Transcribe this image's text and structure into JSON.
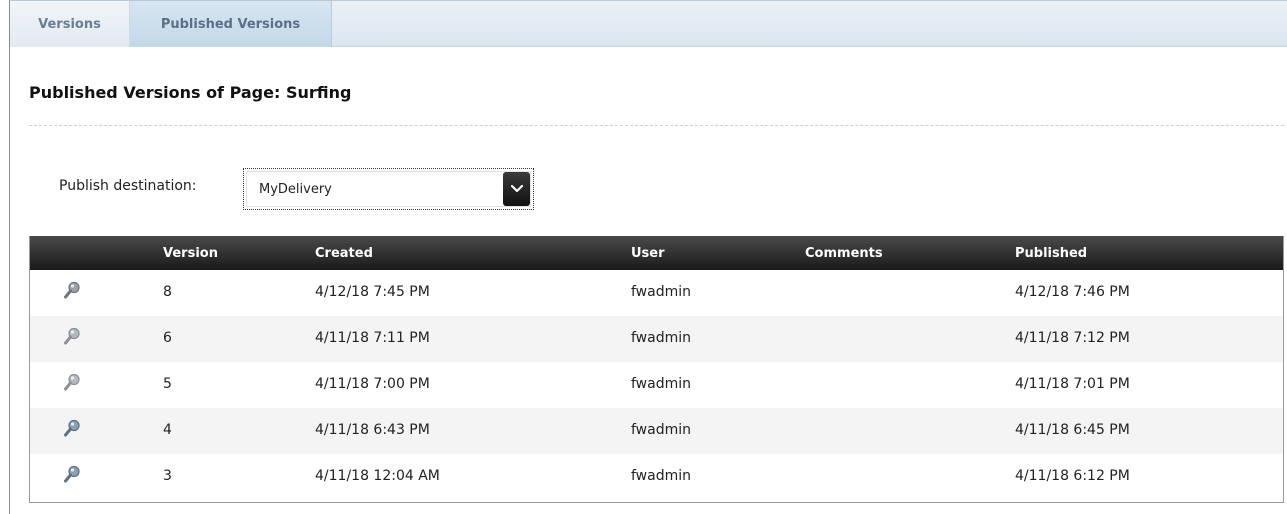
{
  "tabs": [
    {
      "label": "Versions"
    },
    {
      "label": "Published Versions"
    }
  ],
  "page": {
    "title": "Published Versions of Page: Surfing"
  },
  "destination": {
    "label": "Publish destination:",
    "value": "MyDelivery"
  },
  "table": {
    "columns": {
      "version": "Version",
      "created": "Created",
      "user": "User",
      "comments": "Comments",
      "published": "Published"
    },
    "rows": [
      {
        "version": "8",
        "created": "4/12/18 7:45 PM",
        "user": "fwadmin",
        "comments": "",
        "published": "4/12/18 7:46 PM",
        "icon": "magnifier-icon"
      },
      {
        "version": "6",
        "created": "4/11/18 7:11 PM",
        "user": "fwadmin",
        "comments": "",
        "published": "4/11/18 7:12 PM",
        "icon": "magnifier-icon"
      },
      {
        "version": "5",
        "created": "4/11/18 7:00 PM",
        "user": "fwadmin",
        "comments": "",
        "published": "4/11/18 7:01 PM",
        "icon": "magnifier-icon"
      },
      {
        "version": "4",
        "created": "4/11/18 6:43 PM",
        "user": "fwadmin",
        "comments": "",
        "published": "4/11/18 6:45 PM",
        "icon": "magnifier-icon"
      },
      {
        "version": "3",
        "created": "4/11/18 12:04 AM",
        "user": "fwadmin",
        "comments": "",
        "published": "4/11/18 6:12 PM",
        "icon": "magnifier-icon"
      }
    ]
  },
  "colors": {
    "header_bg": "#222222",
    "tab_active": "#c3d8e8",
    "row_alt": "#f4f4f4"
  }
}
